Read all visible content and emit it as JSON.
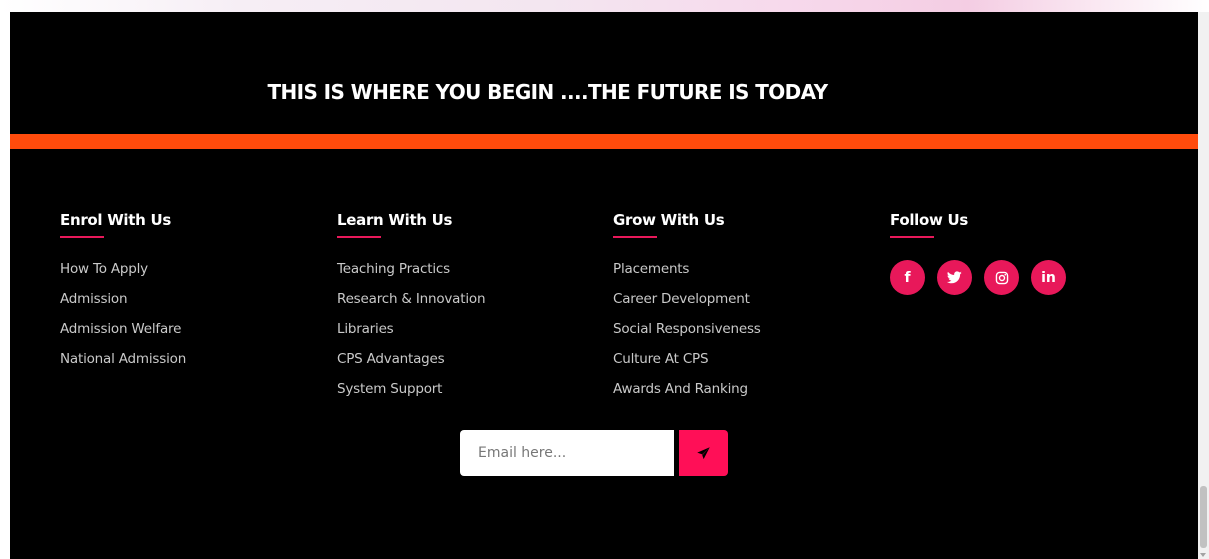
{
  "tagline": "THIS IS WHERE YOU BEGIN ....THE FUTURE IS TODAY",
  "columns": [
    {
      "title": "Enrol With Us",
      "links": [
        "How To Apply",
        "Admission",
        "Admission Welfare",
        "National Admission"
      ]
    },
    {
      "title": "Learn With Us",
      "links": [
        "Teaching Practics",
        "Research & Innovation",
        "Libraries",
        "CPS Advantages",
        "System Support"
      ]
    },
    {
      "title": "Grow With Us",
      "links": [
        "Placements",
        "Career Development",
        "Social Responsiveness",
        "Culture At CPS",
        "Awards And Ranking"
      ]
    }
  ],
  "follow": {
    "title": "Follow Us",
    "icons": [
      {
        "name": "facebook-icon",
        "glyph": "f"
      },
      {
        "name": "twitter-icon",
        "glyph": ""
      },
      {
        "name": "instagram-icon",
        "glyph": ""
      },
      {
        "name": "linkedin-icon",
        "glyph": "in"
      }
    ]
  },
  "subscribe": {
    "placeholder": "Email here...",
    "button_icon": "paper-plane-icon"
  },
  "colors": {
    "background": "#000000",
    "accent_bar": "#ff4b0c",
    "pink": "#e8185a",
    "send_button": "#ff0f57"
  }
}
